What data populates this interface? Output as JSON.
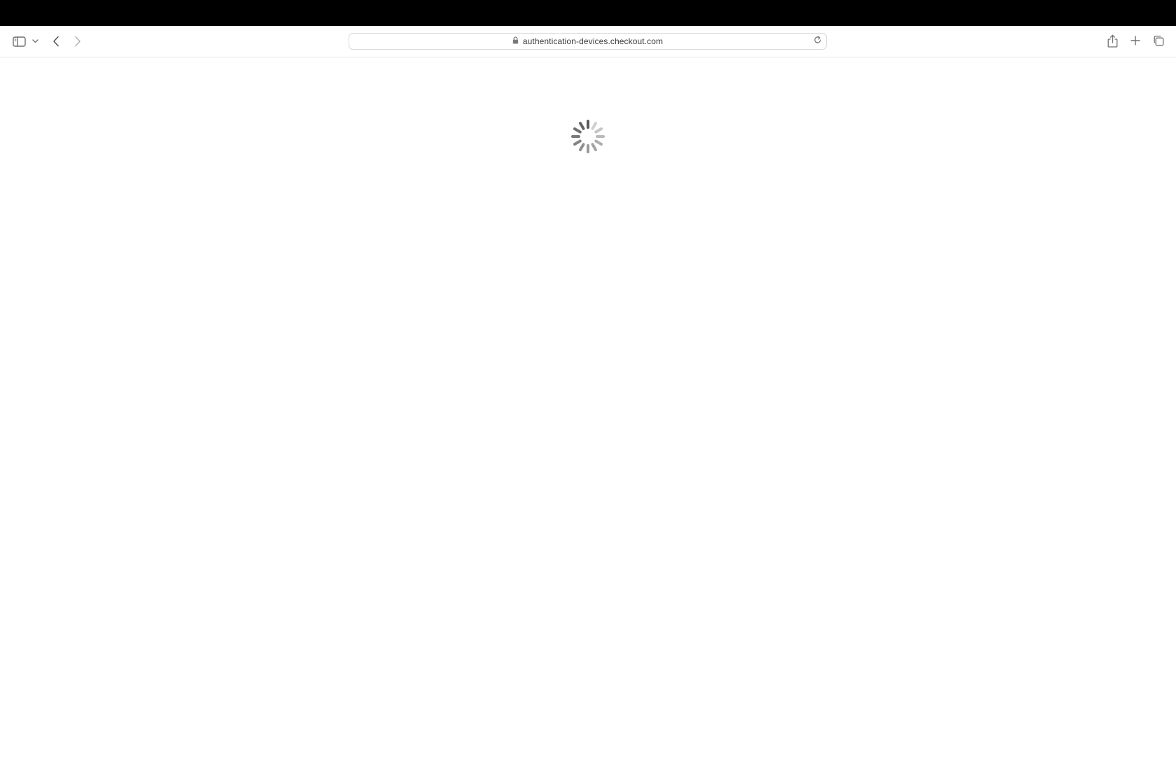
{
  "browser": {
    "address_bar": {
      "url": "authentication-devices.checkout.com",
      "secure": true
    },
    "toolbar": {
      "icons": {
        "sidebar": "sidebar-icon",
        "sidebar_menu": "chevron-down-icon",
        "back": "chevron-left-icon",
        "forward": "chevron-right-icon",
        "lock": "lock-icon",
        "reload": "reload-icon",
        "share": "share-icon",
        "new_tab": "plus-icon",
        "tab_overview": "tabs-overview-icon"
      }
    }
  },
  "page": {
    "state": "loading",
    "indicator": "spinner-icon"
  },
  "colors": {
    "chrome_top": "#000000",
    "toolbar_bg": "#ffffff",
    "icon": "#6e6e6e",
    "spinner": "#5a5a5a"
  }
}
